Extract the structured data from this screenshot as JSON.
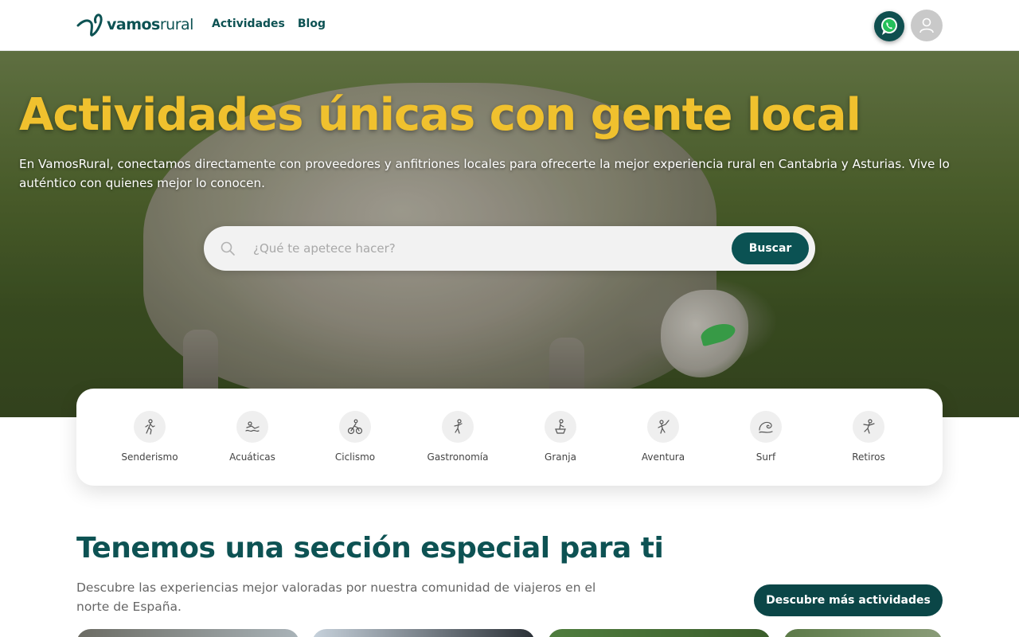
{
  "header": {
    "logo_prefix": "vamos",
    "logo_suffix": "rural",
    "nav": [
      {
        "label": "Actividades"
      },
      {
        "label": "Blog"
      }
    ]
  },
  "hero": {
    "title": "Actividades únicas con gente local",
    "subtitle": "En VamosRural, conectamos directamente con proveedores y anfitriones locales para ofrecerte la mejor experiencia rural en Cantabria y Asturias. Vive lo auténtico con quienes mejor lo conocen.",
    "search": {
      "placeholder": "¿Qué te apetece hacer?",
      "value": "",
      "button_label": "Buscar"
    }
  },
  "categories": [
    {
      "label": "Senderismo",
      "icon": "hiking-icon"
    },
    {
      "label": "Acuáticas",
      "icon": "water-sports-icon"
    },
    {
      "label": "Ciclismo",
      "icon": "cycling-icon"
    },
    {
      "label": "Gastronomía",
      "icon": "gastronomy-icon"
    },
    {
      "label": "Granja",
      "icon": "farm-icon"
    },
    {
      "label": "Aventura",
      "icon": "adventure-icon"
    },
    {
      "label": "Surf",
      "icon": "surf-icon"
    },
    {
      "label": "Retiros",
      "icon": "retreat-icon"
    }
  ],
  "section": {
    "title": "Tenemos una sección especial para ti",
    "description": "Descubre las experiencias mejor valoradas por nuestra comunidad de viajeros en el norte de España.",
    "button_label": "Descubre más actividades"
  },
  "colors": {
    "brand": "#0b5253",
    "accent": "#f0c12e",
    "whatsapp_bg": "#0f4f4f"
  }
}
